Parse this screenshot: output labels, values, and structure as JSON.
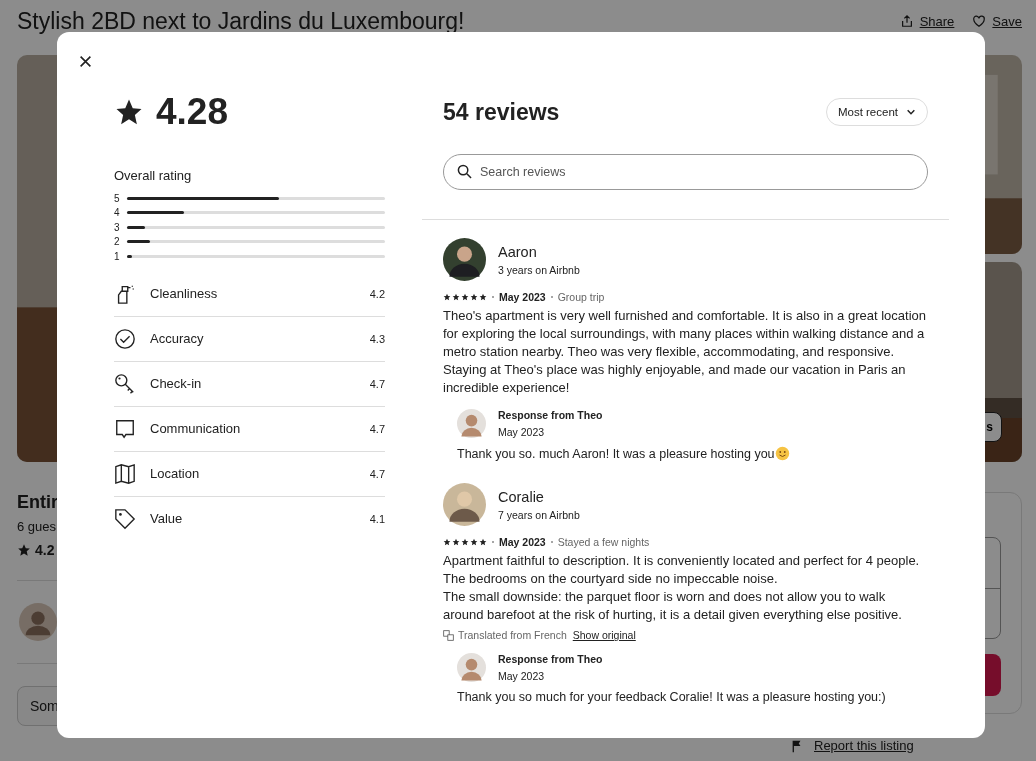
{
  "page": {
    "title": "Stylish 2BD next to Jardins du Luxembourg!",
    "actions": [
      {
        "kind": "share",
        "label": "Share"
      },
      {
        "kind": "save",
        "label": "Save"
      }
    ],
    "photo_button": "s",
    "listing": {
      "heading": "Entir",
      "guests": "6 gues",
      "rating": "4.2"
    },
    "show_more": "Som",
    "report": "Report this listing"
  },
  "modal": {
    "rating": "4.28",
    "overall": {
      "label": "Overall rating",
      "bars": [
        {
          "label": "5",
          "level": 0.59
        },
        {
          "label": "4",
          "level": 0.22
        },
        {
          "label": "3",
          "level": 0.07
        },
        {
          "label": "2",
          "level": 0.09
        },
        {
          "label": "1",
          "level": 0.02
        }
      ]
    },
    "categories": [
      {
        "kind": "cleanliness",
        "label": "Cleanliness",
        "score": "4.2"
      },
      {
        "kind": "accuracy",
        "label": "Accuracy",
        "score": "4.3"
      },
      {
        "kind": "checkin",
        "label": "Check-in",
        "score": "4.7"
      },
      {
        "kind": "communication",
        "label": "Communication",
        "score": "4.7"
      },
      {
        "kind": "location",
        "label": "Location",
        "score": "4.7"
      },
      {
        "kind": "value",
        "label": "Value",
        "score": "4.1"
      }
    ],
    "reviews_count": "54 reviews",
    "sort": "Most recent",
    "search": {
      "placeholder": "Search reviews"
    },
    "reviews": [
      {
        "name": "Aaron",
        "tenure": "3 years on Airbnb",
        "stars": 5,
        "date": "May 2023",
        "trip": "Group trip",
        "paragraphs": [
          "Theo's apartment is very well furnished and comfortable. It is also in a great location for exploring the local surroundings, with many places within walking distance and a metro station nearby. Theo was very flexible, accommodating, and responsive. Staying at Theo's place was highly enjoyable, and made our vacation in Paris an incredible experience!"
        ],
        "response": {
          "title": "Response from Theo",
          "date": "May 2023",
          "text": "Thank you so. much Aaron! It was a pleasure hosting you",
          "emoji": true
        }
      },
      {
        "name": "Coralie",
        "tenure": "7 years on Airbnb",
        "stars": 5,
        "date": "May 2023",
        "trip": "Stayed a few nights",
        "paragraphs": [
          "Apartment faithful to description. It is conveniently located and perfect for 4 people. The bedrooms on the courtyard side no impeccable noise.",
          "The small downside: the parquet floor is worn and does not allow you to walk around barefoot at the risk of hurting, it is a detail given everything else positive."
        ],
        "translation": {
          "note": "Translated from French",
          "link": "Show original"
        },
        "response": {
          "title": "Response from Theo",
          "date": "May 2023",
          "text": "Thank you so much for your feedback Coralie! It was a pleasure hosting you:)",
          "emoji": false
        }
      }
    ]
  }
}
